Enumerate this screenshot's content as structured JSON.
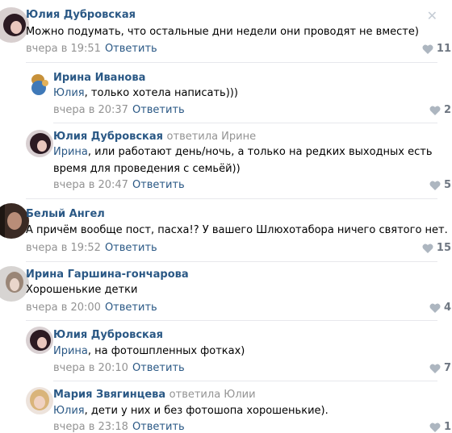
{
  "comments": [
    {
      "author": "Юлия Дубровская",
      "replied_to": "",
      "mention": "",
      "text_lines": [
        "Можно подумать, что остальные дни недели они проводят не вместе)"
      ],
      "time": "вчера в 19:51",
      "reply_label": "Ответить",
      "likes": "11"
    },
    {
      "author": "Ирина Иванова",
      "replied_to": "",
      "mention": "Юлия",
      "text_lines": [
        ", только хотела написать)))"
      ],
      "time": "вчера в 20:37",
      "reply_label": "Ответить",
      "likes": "2"
    },
    {
      "author": "Юлия Дубровская",
      "replied_to": "ответила Ирине",
      "mention": "Ирина",
      "text_lines": [
        ", или работают день/ночь, а только на редких выходных есть",
        "время для проведения с семьёй))"
      ],
      "time": "вчера в 20:47",
      "reply_label": "Ответить",
      "likes": "5"
    },
    {
      "author": "Белый Ангел",
      "replied_to": "",
      "mention": "",
      "text_lines": [
        "А причём вообще пост, пасха!? У вашего Шлюхотабора ничего святого нет."
      ],
      "time": "вчера в 19:52",
      "reply_label": "Ответить",
      "likes": "15"
    },
    {
      "author": "Ирина Гаршина-гончарова",
      "replied_to": "",
      "mention": "",
      "text_lines": [
        "Хорошенькие детки"
      ],
      "time": "вчера в 20:00",
      "reply_label": "Ответить",
      "likes": "4"
    },
    {
      "author": "Юлия Дубровская",
      "replied_to": "",
      "mention": "Ирина",
      "text_lines": [
        ", на фотошпленных фотках)"
      ],
      "time": "вчера в 20:10",
      "reply_label": "Ответить",
      "likes": "7"
    },
    {
      "author": "Мария Звягинцева",
      "replied_to": "ответила Юлии",
      "mention": "Юлия",
      "text_lines": [
        ", дети у них и без фотошопа хорошенькие)."
      ],
      "time": "вчера в 23:18",
      "reply_label": "Ответить",
      "likes": "1"
    }
  ],
  "colors": {
    "link": "#2a5885",
    "meta": "#939393",
    "separator": "#e7e8ec",
    "like_icon": "#adb6c0"
  },
  "icons": {
    "close": "close-icon",
    "like": "heart-icon"
  }
}
